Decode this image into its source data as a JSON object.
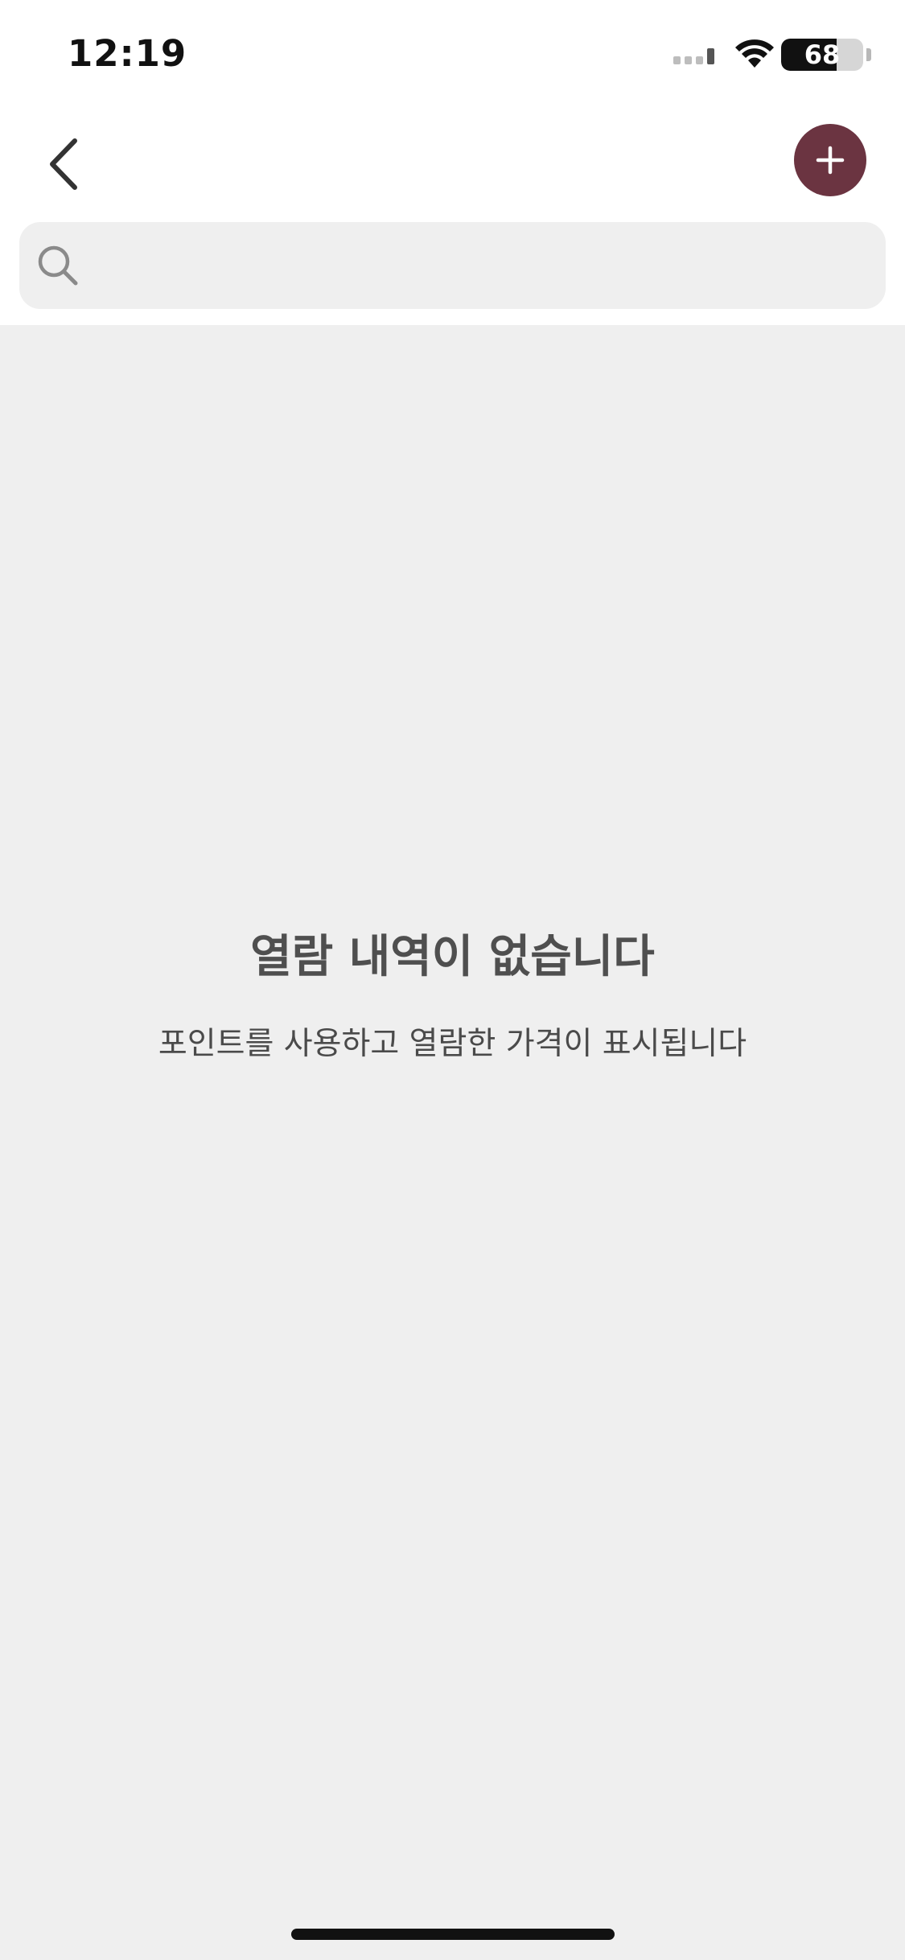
{
  "status_bar": {
    "time": "12:19",
    "battery_level": "68",
    "battery_fraction": 0.68,
    "icons": [
      "cellular-signal-icon",
      "wifi-icon",
      "battery-icon"
    ]
  },
  "nav": {
    "back_icon": "chevron-left-icon",
    "add_icon": "plus-icon",
    "add_button_color": "#6b3441"
  },
  "search": {
    "value": "",
    "icon": "search-icon"
  },
  "empty_state": {
    "title": "열람 내역이 없습니다",
    "subtitle": "포인트를 사용하고 열람한 가격이 표시됩니다"
  },
  "colors": {
    "background": "#efefef",
    "accent": "#6b3441"
  }
}
